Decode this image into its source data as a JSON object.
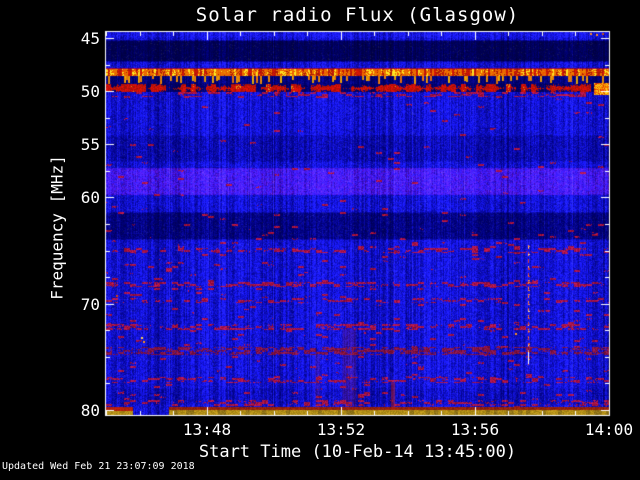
{
  "title": "Solar radio Flux (Glasgow)",
  "footer": {
    "updated": "Updated Wed Feb 21 23:07:09 2018"
  },
  "x_axis": {
    "label": "Start Time (10-Feb-14 13:45:00)",
    "start_time": "13:45:00",
    "end_time": "14:00",
    "duration_min": 15,
    "major_ticks": [
      {
        "t": 3,
        "label": "13:48"
      },
      {
        "t": 7,
        "label": "13:52"
      },
      {
        "t": 11,
        "label": "13:56"
      },
      {
        "t": 15,
        "label": "14:00"
      }
    ],
    "minor_ticks_min": [
      0,
      1,
      2,
      4,
      5,
      6,
      8,
      9,
      10,
      12,
      13,
      14
    ]
  },
  "y_axis": {
    "label": "Frequency [MHz]",
    "min_mhz": 44.44,
    "max_mhz": 80.47,
    "major_ticks": [
      {
        "f": 45,
        "label": "45"
      },
      {
        "f": 50,
        "label": "50"
      },
      {
        "f": 55,
        "label": "55"
      },
      {
        "f": 60,
        "label": "60"
      },
      {
        "f": 70,
        "label": "70"
      },
      {
        "f": 80,
        "label": "80"
      }
    ],
    "minor_ticks": [
      47.5,
      52.5,
      57.5,
      62.5,
      65,
      67.5,
      72.5,
      75,
      77.5
    ]
  },
  "colors": {
    "background": "#000000",
    "frame": "#ffffff",
    "text": "#ffffff",
    "base_blue": "#1111c8",
    "rfi_red": "#cc2200",
    "rfi_orange": "#ee6600",
    "rfi_yellow": "#ffcc33",
    "bottom_yellow": "#b89a10",
    "speckle_red": "#aa1100"
  },
  "chart_data": {
    "type": "heatmap",
    "title": "Solar radio Flux (Glasgow)",
    "xlabel": "Start Time (10-Feb-14 13:45:00)",
    "ylabel": "Frequency [MHz]",
    "x_range_time": [
      "13:45:00",
      "14:00:00"
    ],
    "x_tick_labels": [
      "13:48",
      "13:52",
      "13:56",
      "14:00"
    ],
    "y_range_mhz": [
      44.44,
      80.47
    ],
    "y_tick_labels": [
      "45",
      "50",
      "55",
      "60",
      "70",
      "80"
    ],
    "y_axis_inverted": true,
    "colormap": "quiet background dark blue; interference red/orange/yellow",
    "legend": "none",
    "grid": false,
    "features": [
      {
        "kind": "bright_band",
        "f0": 44.44,
        "f1": 45.05,
        "level": 1.15,
        "description": "brighter noise strip at very top edge"
      },
      {
        "kind": "dark_band",
        "f0": 45.2,
        "f1": 47.25,
        "level": 0.32,
        "description": "very dark quiet band below top edge"
      },
      {
        "kind": "rfi_solid",
        "f0": 47.83,
        "f1": 48.58,
        "description": "continuous strong RFI carrier, red/orange with yellow bursts"
      },
      {
        "kind": "yellow_teeth",
        "f0": 48.58,
        "f1": 49.33,
        "tooth_density": 0.27,
        "description": "dark gap with regular vertical orange/yellow tick bursts"
      },
      {
        "kind": "rfi_broken",
        "f0": 49.33,
        "f1": 50.05,
        "description": "broken/dashed red RFI band"
      },
      {
        "kind": "speckle",
        "f0": 50.1,
        "f1": 50.6,
        "density": 0.25,
        "strong": false
      },
      {
        "kind": "dim_band",
        "f0": 54.1,
        "f1": 56.65,
        "level": 0.8,
        "description": "slightly darker band"
      },
      {
        "kind": "bright_band",
        "f0": 57.2,
        "f1": 59.8,
        "level": 1.28,
        "tinge": 1,
        "description": "brighter blue band with reddish tinge"
      },
      {
        "kind": "dark_band",
        "f0": 61.4,
        "f1": 64.0,
        "level": 0.55,
        "description": "dark quiet band"
      },
      {
        "kind": "speckle",
        "f0": 64.75,
        "f1": 65.25,
        "density": 0.3,
        "strong": false
      },
      {
        "kind": "speckle",
        "f0": 67.95,
        "f1": 68.45,
        "density": 0.4,
        "strong": false
      },
      {
        "kind": "speckle",
        "f0": 69.45,
        "f1": 69.95,
        "density": 0.25,
        "strong": false
      },
      {
        "kind": "speckle",
        "f0": 71.95,
        "f1": 72.5,
        "density": 0.4,
        "strong": false
      },
      {
        "kind": "speckle",
        "f0": 74.05,
        "f1": 74.85,
        "density": 0.55,
        "strong": true,
        "description": "dense dark-red dashed interference line"
      },
      {
        "kind": "dim_band",
        "f0": 77.9,
        "f1": 79.5,
        "level": 0.88
      },
      {
        "kind": "speckle",
        "f0": 76.9,
        "f1": 77.5,
        "density": 0.32,
        "strong": false
      },
      {
        "kind": "speckle",
        "f0": 79.05,
        "f1": 79.65,
        "density": 0.32,
        "strong": false
      },
      {
        "kind": "bottom_band",
        "f0": 79.75,
        "f1": 80.47,
        "gap_t": [
          0.8,
          1.85
        ],
        "description": "saturated yellow channel at bottom with maroon upper edge; blue gap near 13:45:50-13:46:50"
      },
      {
        "kind": "right_blob",
        "f0": 49.2,
        "f1": 50.35,
        "t0": 14.55,
        "description": "bright orange saturation at right edge of RFI band"
      },
      {
        "kind": "vline_dashed",
        "t": 12.58,
        "f0": 64.5,
        "f1": 75.75,
        "description": "dashed red/orange vertical interference line near 13:57:35"
      },
      {
        "kind": "vline_white",
        "t": 12.58,
        "f0": 74.5,
        "f1": 75.65,
        "description": "short bright white vertical segment"
      },
      {
        "kind": "vstreak",
        "t0": 7.05,
        "t1": 7.46,
        "f0": 72.4,
        "f1": 79.9,
        "alpha": 0.18
      },
      {
        "kind": "vstreak",
        "t0": 6.23,
        "t1": 6.38,
        "f0": 74.5,
        "f1": 79.8,
        "alpha": 0.14
      },
      {
        "kind": "vstreak",
        "t0": 8.5,
        "t1": 8.62,
        "f0": 77.4,
        "f1": 79.9,
        "alpha": 0.5
      },
      {
        "kind": "dot",
        "t": 1.04,
        "f": 73.13,
        "color": "#ffd24a"
      },
      {
        "kind": "dot",
        "t": 1.1,
        "f": 73.5,
        "color": "#ff9020"
      },
      {
        "kind": "dot",
        "t": 0.3,
        "f": 69.18,
        "color": "#d84010"
      },
      {
        "kind": "dot",
        "t": 12.2,
        "f": 72.75,
        "color": "#ff9020"
      },
      {
        "kind": "dot",
        "t": 14.42,
        "f": 44.55,
        "color": "#ff8820"
      },
      {
        "kind": "dot",
        "t": 14.6,
        "f": 44.6,
        "color": "#ff8820"
      },
      {
        "kind": "dot",
        "t": 14.78,
        "f": 44.55,
        "color": "#cc5510"
      }
    ],
    "annotations": [
      "Updated Wed Feb 21 23:07:09 2018"
    ]
  }
}
